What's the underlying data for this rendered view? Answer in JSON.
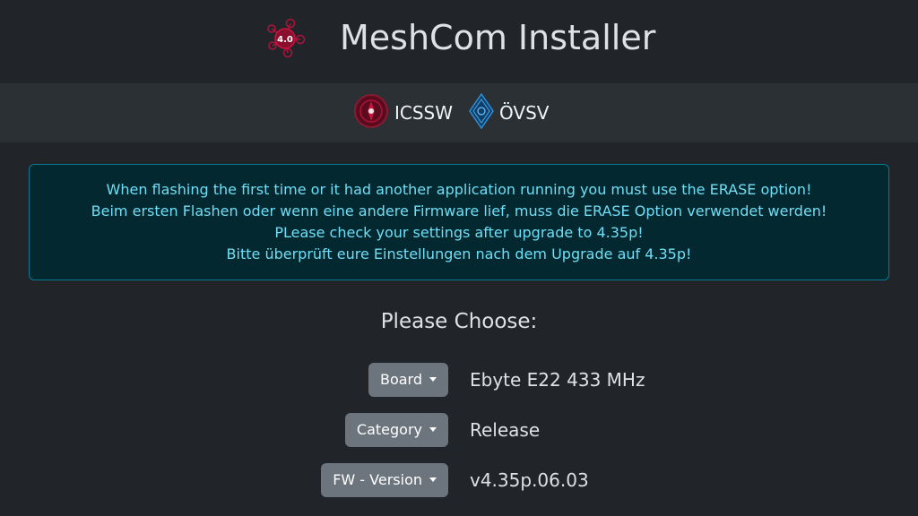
{
  "header": {
    "title": "MeshCom Installer",
    "logo_badge": "4.0",
    "logo_icon": "meshcom-network-icon"
  },
  "partners": [
    {
      "label": "ICSSW",
      "icon": "icssw-seal-icon"
    },
    {
      "label": "ÖVSV",
      "icon": "ovsv-diamond-icon"
    }
  ],
  "alert": {
    "lines": [
      "When flashing the first time or it had another application running you must use the ERASE option!",
      "Beim ersten Flashen oder wenn eine andere Firmware lief, muss die ERASE Option verwendet werden!",
      "PLease check your settings after upgrade to 4.35p!",
      "Bitte überprüft eure Einstellungen nach dem Upgrade auf 4.35p!"
    ]
  },
  "chooser": {
    "heading": "Please Choose:",
    "rows": [
      {
        "button": "Board",
        "value": "Ebyte E22 433 MHz"
      },
      {
        "button": "Category",
        "value": "Release"
      },
      {
        "button": "FW - Version",
        "value": "v4.35p.06.03"
      }
    ]
  },
  "colors": {
    "background": "#212529",
    "partner_bar": "#2b3035",
    "alert_bg": "#032830",
    "alert_border": "#087990",
    "alert_text": "#6edff6",
    "button_bg": "#6c757d",
    "logo_red": "#b0123a",
    "ovsv_blue": "#1e7fc9"
  }
}
